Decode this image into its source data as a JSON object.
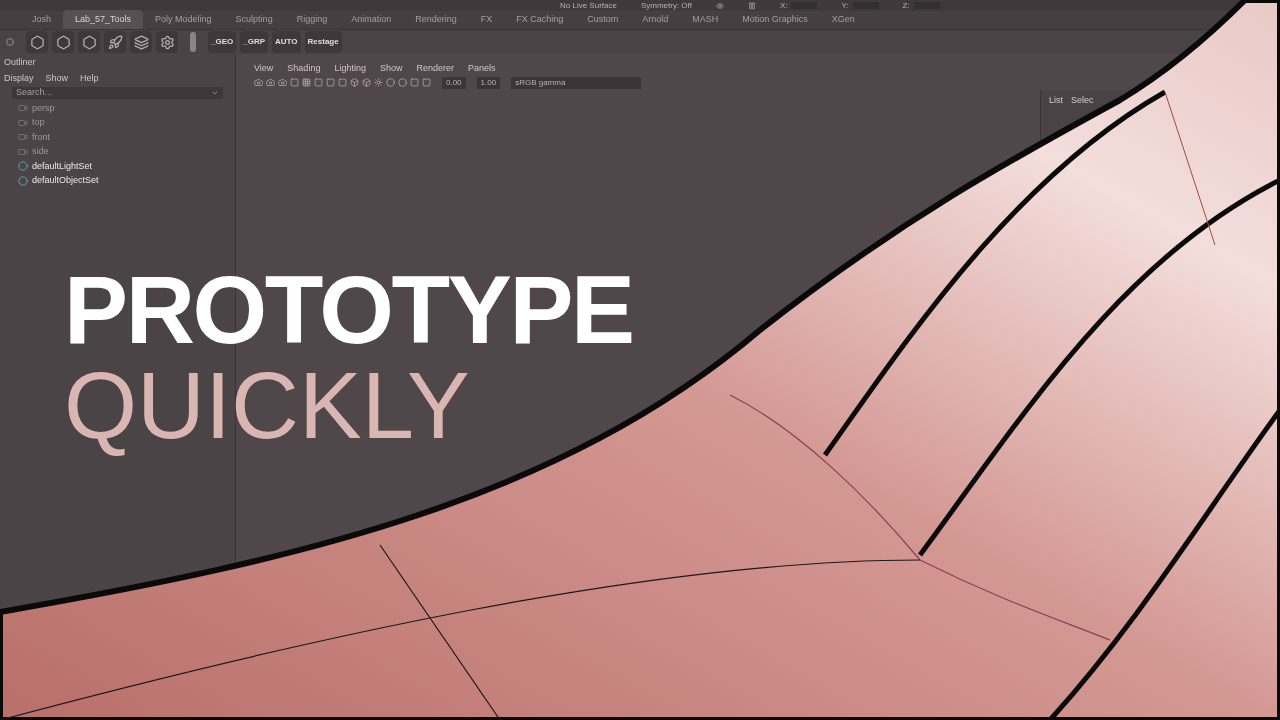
{
  "status_line": {
    "live_surface": "No Live Surface",
    "symmetry": "Symmetry: Off",
    "coords": [
      "X:",
      "Y:",
      "Z:"
    ]
  },
  "shelf_tabs": [
    {
      "label": "Josh",
      "selected": false
    },
    {
      "label": "Lab_57_Tools",
      "selected": true
    },
    {
      "label": "Poly Modeling",
      "selected": false
    },
    {
      "label": "Sculpting",
      "selected": false
    },
    {
      "label": "Rigging",
      "selected": false
    },
    {
      "label": "Animation",
      "selected": false
    },
    {
      "label": "Rendering",
      "selected": false
    },
    {
      "label": "FX",
      "selected": false
    },
    {
      "label": "FX Caching",
      "selected": false
    },
    {
      "label": "Custom",
      "selected": false
    },
    {
      "label": "Arnold",
      "selected": false
    },
    {
      "label": "MASH",
      "selected": false
    },
    {
      "label": "Motion Graphics",
      "selected": false
    },
    {
      "label": "XGen",
      "selected": false
    }
  ],
  "shelf_buttons": [
    "_GEO",
    "_GRP",
    "AUTO",
    "Restage"
  ],
  "outliner": {
    "title": "Outliner",
    "menu": [
      "Display",
      "Show",
      "Help"
    ],
    "search": {
      "placeholder": "Search..."
    },
    "items": [
      {
        "label": "persp",
        "kind": "camera",
        "dimmed": true
      },
      {
        "label": "top",
        "kind": "camera",
        "dimmed": true
      },
      {
        "label": "front",
        "kind": "camera",
        "dimmed": true
      },
      {
        "label": "side",
        "kind": "camera",
        "dimmed": true
      },
      {
        "label": "defaultLightSet",
        "kind": "set",
        "dimmed": false
      },
      {
        "label": "defaultObjectSet",
        "kind": "set",
        "dimmed": false
      }
    ]
  },
  "viewport": {
    "menu": [
      "View",
      "Shading",
      "Lighting",
      "Show",
      "Renderer",
      "Panels"
    ],
    "exposure": "0.00",
    "gamma": "1.00",
    "color_space": "sRGB gamma"
  },
  "right_panel": {
    "menu": [
      "List",
      "Selec"
    ]
  },
  "headline": {
    "title": "PROTOTYPE",
    "subtitle": "QUICKLY"
  }
}
